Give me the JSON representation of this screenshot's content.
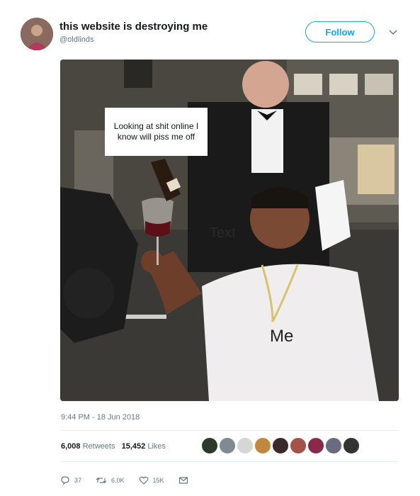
{
  "user": {
    "display_name": "this website is destroying me",
    "handle": "@oldlinds"
  },
  "follow_label": "Follow",
  "image": {
    "caption": "Looking at shit online I know will piss me off",
    "text_label": "Text",
    "me_label": "Me"
  },
  "timestamp": "9:44 PM - 18 Jun 2018",
  "stats": {
    "retweets_count": "6,008",
    "retweets_label": "Retweets",
    "likes_count": "15,452",
    "likes_label": "Likes"
  },
  "likers": [
    "avatar-1",
    "avatar-2",
    "avatar-3",
    "avatar-4",
    "avatar-5",
    "avatar-6",
    "avatar-7",
    "avatar-8",
    "avatar-9"
  ],
  "actions": {
    "reply_count": "37",
    "retweet_count": "6.0K",
    "like_count": "15K"
  },
  "colors": {
    "accent": "#1da1f2",
    "muted": "#657786"
  }
}
